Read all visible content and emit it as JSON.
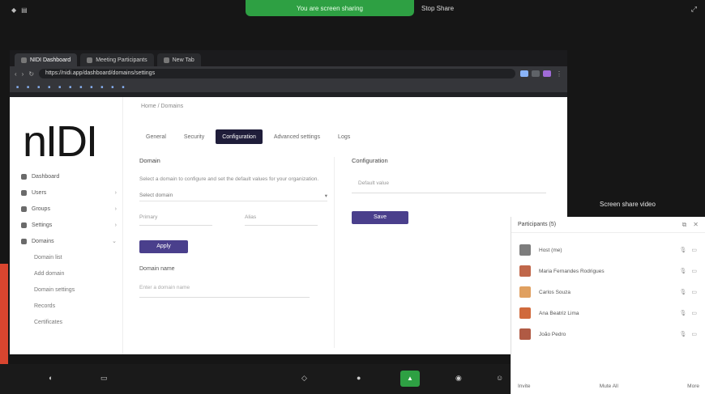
{
  "meeting": {
    "screen_share_label": "You are screen sharing",
    "stop_share_label": "Stop Share"
  },
  "browser": {
    "tabs": [
      {
        "label": "NIDI Dashboard"
      },
      {
        "label": "Meeting Participants"
      },
      {
        "label": "New Tab"
      }
    ],
    "url": "https://nidi.app/dashboard/domains/settings"
  },
  "app": {
    "logo": "nIDI",
    "breadcrumb": "Home / Domains",
    "sidebar": {
      "items": [
        {
          "label": "Dashboard",
          "chevron": ""
        },
        {
          "label": "Users",
          "chevron": "›"
        },
        {
          "label": "Groups",
          "chevron": "›"
        },
        {
          "label": "Settings",
          "chevron": "›"
        },
        {
          "label": "Domains",
          "chevron": "⌄"
        }
      ],
      "subitems": [
        {
          "label": "Domain list"
        },
        {
          "label": "Add domain"
        },
        {
          "label": "Domain settings"
        },
        {
          "label": "Records"
        },
        {
          "label": "Certificates"
        }
      ]
    },
    "tabs": [
      {
        "label": "General"
      },
      {
        "label": "Security"
      },
      {
        "label": "Configuration"
      },
      {
        "label": "Advanced settings"
      },
      {
        "label": "Logs"
      }
    ],
    "left_panel": {
      "title": "Domain",
      "description": "Select a domain to configure and set the default values for your organization.",
      "select_value": "Select domain",
      "field_a": "Primary",
      "field_b": "Alias",
      "apply_button": "Apply",
      "sub_title": "Domain name",
      "wide_field": "Enter a domain name"
    },
    "right_panel": {
      "title": "Configuration",
      "field": "Default value",
      "save_button": "Save"
    }
  },
  "camera_label": "Screen share video",
  "participants": {
    "header": "Participants (5)",
    "rows": [
      {
        "name": "Host (me)",
        "color": "#7d7d7d"
      },
      {
        "name": "Maria Fernandes Rodrigues",
        "color": "#c0674a"
      },
      {
        "name": "Carlos Souza",
        "color": "#e0a060"
      },
      {
        "name": "Ana Beatriz Lima",
        "color": "#d06a3c"
      },
      {
        "name": "João Pedro",
        "color": "#b05a44"
      }
    ],
    "footer": {
      "invite": "Invite",
      "mute_all": "Mute All",
      "more": "More"
    }
  },
  "colors": {
    "accent": "#4a3f8c",
    "share_green": "#2ea043",
    "active_tab": "#1f1d3a"
  }
}
